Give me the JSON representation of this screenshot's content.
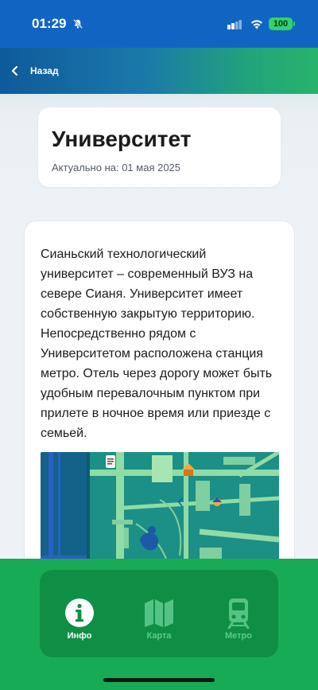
{
  "status_bar": {
    "time": "01:29",
    "battery": "100"
  },
  "nav": {
    "back_label": "Назад"
  },
  "header": {
    "title": "Университет",
    "date": "Актуально на: 01 мая 2025"
  },
  "content": {
    "description": "Сианьский технологический университет – современный ВУЗ на севере Сианя. Университет имеет собственную закрытую территорию. Непосредственно рядом с Университетом расположена станция метро. Отель через дорогу может быть удобным перевалочным пунктом при прилете в ночное время или приезде с семьей."
  },
  "tabs": [
    {
      "label": "Инфо",
      "icon": "info-icon",
      "active": true
    },
    {
      "label": "Карта",
      "icon": "map-icon",
      "active": false
    },
    {
      "label": "Метро",
      "icon": "train-icon",
      "active": false
    }
  ],
  "colors": {
    "accent": "#18ab56",
    "status_bar": "#1165c2",
    "map_bg": "#1c8f86",
    "map_roads": "#9be3a8"
  }
}
